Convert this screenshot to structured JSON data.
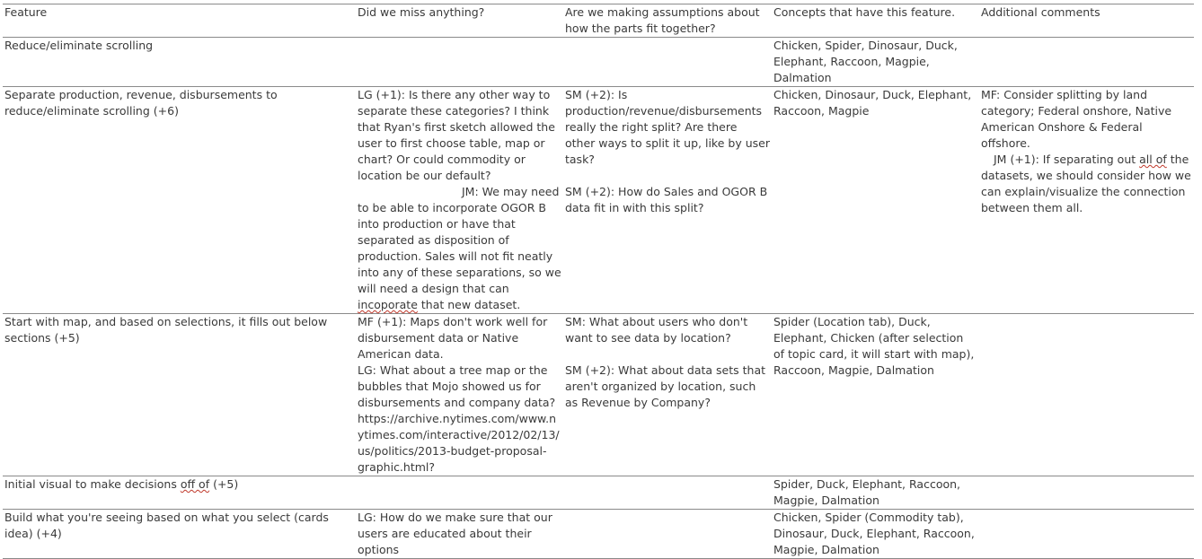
{
  "headers": [
    "Feature",
    "Did we miss anything?",
    "Are we making assumptions about how the parts fit together?",
    "Concepts that have this feature.",
    "Additional comments"
  ],
  "rows": [
    {
      "feature": "Reduce/eliminate scrolling",
      "missed": [],
      "assumptions": [],
      "concepts": "Chicken, Spider, Dinosaur, Duck, Elephant, Raccoon, Magpie, Dalmation",
      "comments": []
    },
    {
      "feature": "Separate production, revenue, disbursements to reduce/eliminate scrolling (+6)",
      "missed": [
        "LG (+1): Is there any other way to separate these categories? I think that Ryan's first sketch allowed the user to first choose table, map or chart? Or could commodity or location be our default?",
        "JM: We may need to be able to incorporate OGOR B into production or have that separated as disposition of production. Sales will not fit neatly into any of these separations, so we will need a design that can",
        "incoporate",
        "that new dataset."
      ],
      "assumptions": [
        "SM (+2): Is production/revenue/disbursements really the right split? Are there other ways to split it up, like by user task?",
        "SM (+2): How do Sales and OGOR B data fit in with this split?"
      ],
      "concepts": "Chicken, Dinosaur, Duck, Elephant, Raccoon, Magpie",
      "comments": [
        "MF: Consider splitting by land category; Federal onshore, Native American Onshore & Federal offshore.",
        "JM (+1): If separating out ",
        "all of",
        " the datasets, we should consider how we can explain/visualize the connection between them all."
      ]
    },
    {
      "feature": "Start with map, and based on selections, it fills out below sections (+5)",
      "missed": [
        "MF (+1): Maps don't work well for disbursement data or Native American data.",
        "LG: What about a tree map or the bubbles that Mojo showed us for disbursements and company data? https://archive.nytimes.com/www.nytimes.com/interactive/2012/02/13/us/politics/2013-budget-proposal-graphic.html?"
      ],
      "assumptions": [
        "SM: What about users who don't want to see data by location?",
        "SM (+2): What about data sets that aren't organized by location, such as Revenue by Company?"
      ],
      "concepts": "Spider (Location tab), Duck, Elephant, Chicken (after selection of topic card, it will start with map), Raccoon, Magpie, Dalmation",
      "comments": []
    },
    {
      "feature_pre": "Initial visual to make decisions ",
      "feature_mark": "off of",
      "feature_post": " (+5)",
      "missed": [],
      "assumptions": [],
      "concepts": "Spider, Duck, Elephant, Raccoon, Magpie, Dalmation",
      "comments": []
    },
    {
      "feature": "Build what you're seeing based on what you select (cards idea) (+4)",
      "missed": [
        "LG: How do we make sure that our users are educated about their options"
      ],
      "assumptions": [],
      "concepts": "Chicken, Spider (Commodity tab), Dinosaur, Duck, Elephant, Raccoon, Magpie, Dalmation",
      "comments": []
    }
  ]
}
